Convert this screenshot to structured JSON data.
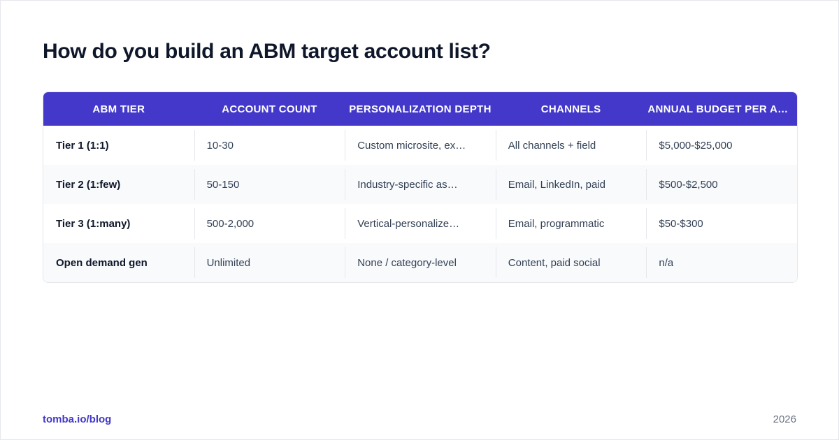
{
  "title": "How do you build an ABM target account list?",
  "table": {
    "headers": [
      "ABM TIER",
      "ACCOUNT COUNT",
      "PERSONALIZATION DEPTH",
      "CHANNELS",
      "ANNUAL BUDGET PER AC…"
    ],
    "rows": [
      [
        "Tier 1 (1:1)",
        "10-30",
        "Custom microsite, ex…",
        "All channels + field",
        "$5,000-$25,000"
      ],
      [
        "Tier 2 (1:few)",
        "50-150",
        "Industry-specific as…",
        "Email, LinkedIn, paid",
        "$500-$2,500"
      ],
      [
        "Tier 3 (1:many)",
        "500-2,000",
        "Vertical-personalize…",
        "Email, programmatic",
        "$50-$300"
      ],
      [
        "Open demand gen",
        "Unlimited",
        "None / category-level",
        "Content, paid social",
        "n/a"
      ]
    ]
  },
  "footer": {
    "source": "tomba.io/blog",
    "year": "2026"
  },
  "colors": {
    "accent": "#4338ca",
    "title": "#0f172a",
    "row_alt": "#f8fafc"
  }
}
